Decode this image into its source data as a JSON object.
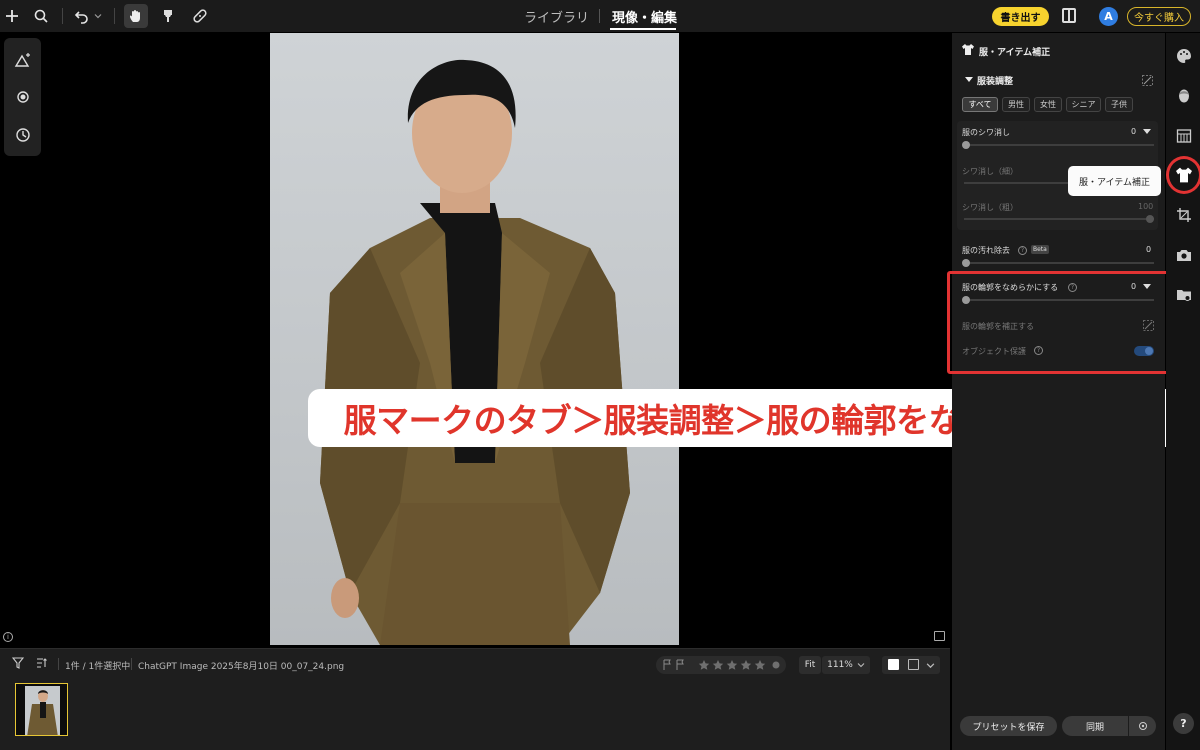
{
  "topbar": {
    "tab_library": "ライブラリ",
    "tab_develop": "現像・編集",
    "export_label": "書き出す",
    "avatar_initial": "A",
    "buy_label": "今すぐ購入"
  },
  "filmstrip": {
    "selection_count": "1件 / 1件選択中",
    "filename": "ChatGPT Image 2025年8月10日 00_07_24.png",
    "fit_label": "Fit",
    "zoom_value": "111%"
  },
  "panel": {
    "title": "服・アイテム補正",
    "section": "服装調整",
    "chips": [
      "すべて",
      "男性",
      "女性",
      "シニア",
      "子供"
    ],
    "wrinkle": {
      "label": "服のシワ消し",
      "value": "0"
    },
    "wrinkle_fine": {
      "label": "シワ消し（細）"
    },
    "wrinkle_coarse": {
      "label": "シワ消し（粗）",
      "value": "100"
    },
    "stain": {
      "label": "服の汚れ除去",
      "badge": "Beta",
      "value": "0"
    },
    "smooth": {
      "label": "服の輪郭をなめらかにする",
      "value": "0"
    },
    "correct_label": "服の輪郭を補正する",
    "protect_label": "オブジェクト保護",
    "protect_on": true,
    "save_preset": "プリセットを保存",
    "sync": "同期"
  },
  "tooltip": "服・アイテム補正",
  "caption": "服マークのタブ＞服装調整＞服の輪郭をなめらかにする",
  "colors": {
    "accent_yellow": "#f7d32e",
    "highlight_red": "#e23333",
    "avatar_blue": "#2f7de1"
  }
}
